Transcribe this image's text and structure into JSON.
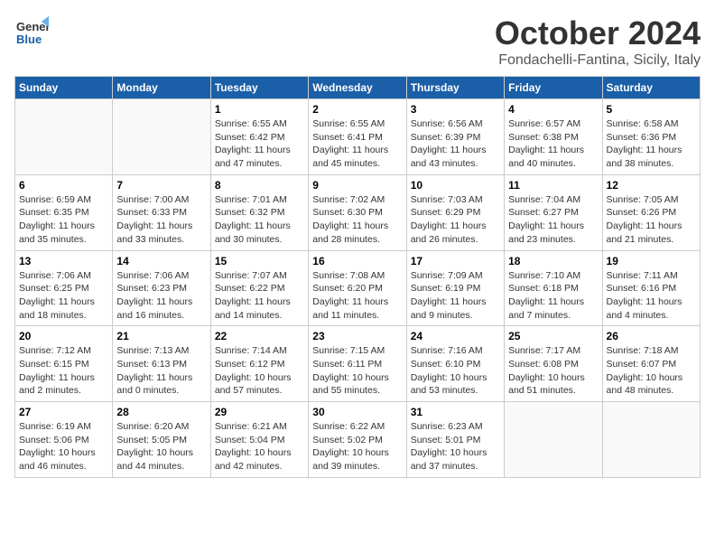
{
  "header": {
    "logo_general": "General",
    "logo_blue": "Blue",
    "month": "October 2024",
    "location": "Fondachelli-Fantina, Sicily, Italy"
  },
  "weekdays": [
    "Sunday",
    "Monday",
    "Tuesday",
    "Wednesday",
    "Thursday",
    "Friday",
    "Saturday"
  ],
  "weeks": [
    [
      {
        "day": "",
        "sunrise": "",
        "sunset": "",
        "daylight": ""
      },
      {
        "day": "",
        "sunrise": "",
        "sunset": "",
        "daylight": ""
      },
      {
        "day": "1",
        "sunrise": "Sunrise: 6:55 AM",
        "sunset": "Sunset: 6:42 PM",
        "daylight": "Daylight: 11 hours and 47 minutes."
      },
      {
        "day": "2",
        "sunrise": "Sunrise: 6:55 AM",
        "sunset": "Sunset: 6:41 PM",
        "daylight": "Daylight: 11 hours and 45 minutes."
      },
      {
        "day": "3",
        "sunrise": "Sunrise: 6:56 AM",
        "sunset": "Sunset: 6:39 PM",
        "daylight": "Daylight: 11 hours and 43 minutes."
      },
      {
        "day": "4",
        "sunrise": "Sunrise: 6:57 AM",
        "sunset": "Sunset: 6:38 PM",
        "daylight": "Daylight: 11 hours and 40 minutes."
      },
      {
        "day": "5",
        "sunrise": "Sunrise: 6:58 AM",
        "sunset": "Sunset: 6:36 PM",
        "daylight": "Daylight: 11 hours and 38 minutes."
      }
    ],
    [
      {
        "day": "6",
        "sunrise": "Sunrise: 6:59 AM",
        "sunset": "Sunset: 6:35 PM",
        "daylight": "Daylight: 11 hours and 35 minutes."
      },
      {
        "day": "7",
        "sunrise": "Sunrise: 7:00 AM",
        "sunset": "Sunset: 6:33 PM",
        "daylight": "Daylight: 11 hours and 33 minutes."
      },
      {
        "day": "8",
        "sunrise": "Sunrise: 7:01 AM",
        "sunset": "Sunset: 6:32 PM",
        "daylight": "Daylight: 11 hours and 30 minutes."
      },
      {
        "day": "9",
        "sunrise": "Sunrise: 7:02 AM",
        "sunset": "Sunset: 6:30 PM",
        "daylight": "Daylight: 11 hours and 28 minutes."
      },
      {
        "day": "10",
        "sunrise": "Sunrise: 7:03 AM",
        "sunset": "Sunset: 6:29 PM",
        "daylight": "Daylight: 11 hours and 26 minutes."
      },
      {
        "day": "11",
        "sunrise": "Sunrise: 7:04 AM",
        "sunset": "Sunset: 6:27 PM",
        "daylight": "Daylight: 11 hours and 23 minutes."
      },
      {
        "day": "12",
        "sunrise": "Sunrise: 7:05 AM",
        "sunset": "Sunset: 6:26 PM",
        "daylight": "Daylight: 11 hours and 21 minutes."
      }
    ],
    [
      {
        "day": "13",
        "sunrise": "Sunrise: 7:06 AM",
        "sunset": "Sunset: 6:25 PM",
        "daylight": "Daylight: 11 hours and 18 minutes."
      },
      {
        "day": "14",
        "sunrise": "Sunrise: 7:06 AM",
        "sunset": "Sunset: 6:23 PM",
        "daylight": "Daylight: 11 hours and 16 minutes."
      },
      {
        "day": "15",
        "sunrise": "Sunrise: 7:07 AM",
        "sunset": "Sunset: 6:22 PM",
        "daylight": "Daylight: 11 hours and 14 minutes."
      },
      {
        "day": "16",
        "sunrise": "Sunrise: 7:08 AM",
        "sunset": "Sunset: 6:20 PM",
        "daylight": "Daylight: 11 hours and 11 minutes."
      },
      {
        "day": "17",
        "sunrise": "Sunrise: 7:09 AM",
        "sunset": "Sunset: 6:19 PM",
        "daylight": "Daylight: 11 hours and 9 minutes."
      },
      {
        "day": "18",
        "sunrise": "Sunrise: 7:10 AM",
        "sunset": "Sunset: 6:18 PM",
        "daylight": "Daylight: 11 hours and 7 minutes."
      },
      {
        "day": "19",
        "sunrise": "Sunrise: 7:11 AM",
        "sunset": "Sunset: 6:16 PM",
        "daylight": "Daylight: 11 hours and 4 minutes."
      }
    ],
    [
      {
        "day": "20",
        "sunrise": "Sunrise: 7:12 AM",
        "sunset": "Sunset: 6:15 PM",
        "daylight": "Daylight: 11 hours and 2 minutes."
      },
      {
        "day": "21",
        "sunrise": "Sunrise: 7:13 AM",
        "sunset": "Sunset: 6:13 PM",
        "daylight": "Daylight: 11 hours and 0 minutes."
      },
      {
        "day": "22",
        "sunrise": "Sunrise: 7:14 AM",
        "sunset": "Sunset: 6:12 PM",
        "daylight": "Daylight: 10 hours and 57 minutes."
      },
      {
        "day": "23",
        "sunrise": "Sunrise: 7:15 AM",
        "sunset": "Sunset: 6:11 PM",
        "daylight": "Daylight: 10 hours and 55 minutes."
      },
      {
        "day": "24",
        "sunrise": "Sunrise: 7:16 AM",
        "sunset": "Sunset: 6:10 PM",
        "daylight": "Daylight: 10 hours and 53 minutes."
      },
      {
        "day": "25",
        "sunrise": "Sunrise: 7:17 AM",
        "sunset": "Sunset: 6:08 PM",
        "daylight": "Daylight: 10 hours and 51 minutes."
      },
      {
        "day": "26",
        "sunrise": "Sunrise: 7:18 AM",
        "sunset": "Sunset: 6:07 PM",
        "daylight": "Daylight: 10 hours and 48 minutes."
      }
    ],
    [
      {
        "day": "27",
        "sunrise": "Sunrise: 6:19 AM",
        "sunset": "Sunset: 5:06 PM",
        "daylight": "Daylight: 10 hours and 46 minutes."
      },
      {
        "day": "28",
        "sunrise": "Sunrise: 6:20 AM",
        "sunset": "Sunset: 5:05 PM",
        "daylight": "Daylight: 10 hours and 44 minutes."
      },
      {
        "day": "29",
        "sunrise": "Sunrise: 6:21 AM",
        "sunset": "Sunset: 5:04 PM",
        "daylight": "Daylight: 10 hours and 42 minutes."
      },
      {
        "day": "30",
        "sunrise": "Sunrise: 6:22 AM",
        "sunset": "Sunset: 5:02 PM",
        "daylight": "Daylight: 10 hours and 39 minutes."
      },
      {
        "day": "31",
        "sunrise": "Sunrise: 6:23 AM",
        "sunset": "Sunset: 5:01 PM",
        "daylight": "Daylight: 10 hours and 37 minutes."
      },
      {
        "day": "",
        "sunrise": "",
        "sunset": "",
        "daylight": ""
      },
      {
        "day": "",
        "sunrise": "",
        "sunset": "",
        "daylight": ""
      }
    ]
  ]
}
